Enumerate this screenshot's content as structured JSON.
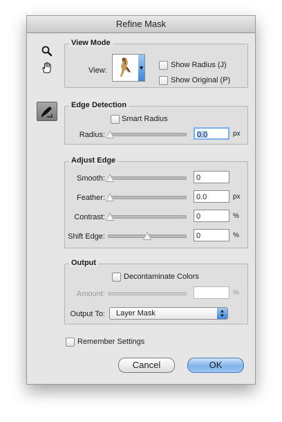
{
  "dialog": {
    "title": "Refine Mask"
  },
  "tools": [
    "zoom-icon",
    "hand-icon",
    "refine-radius-brush-icon"
  ],
  "view_mode": {
    "title": "View Mode",
    "view_label": "View:",
    "show_radius": {
      "label": "Show Radius (J)",
      "checked": false
    },
    "show_original": {
      "label": "Show Original (P)",
      "checked": false
    }
  },
  "edge_detection": {
    "title": "Edge Detection",
    "smart_radius": {
      "label": "Smart Radius",
      "checked": false
    },
    "radius": {
      "label": "Radius:",
      "value": "0.0",
      "unit": "px",
      "level": 0
    }
  },
  "adjust_edge": {
    "title": "Adjust Edge",
    "smooth": {
      "label": "Smooth:",
      "value": "0",
      "unit": "",
      "level": 0
    },
    "feather": {
      "label": "Feather:",
      "value": "0.0",
      "unit": "px",
      "level": 0
    },
    "contrast": {
      "label": "Contrast:",
      "value": "0",
      "unit": "%",
      "level": 0
    },
    "shift_edge": {
      "label": "Shift Edge:",
      "value": "0",
      "unit": "%",
      "level": 0.5
    }
  },
  "output": {
    "title": "Output",
    "decontaminate": {
      "label": "Decontaminate Colors",
      "checked": false
    },
    "amount": {
      "label": "Amount:",
      "value": "",
      "unit": "%"
    },
    "output_to_label": "Output To:",
    "output_to_value": "Layer Mask"
  },
  "remember_settings": {
    "label": "Remember Settings",
    "checked": false
  },
  "buttons": {
    "cancel": "Cancel",
    "ok": "OK"
  },
  "colors": {
    "ok_blue": "#7fb3ea",
    "panel": "#e6e6e6"
  }
}
